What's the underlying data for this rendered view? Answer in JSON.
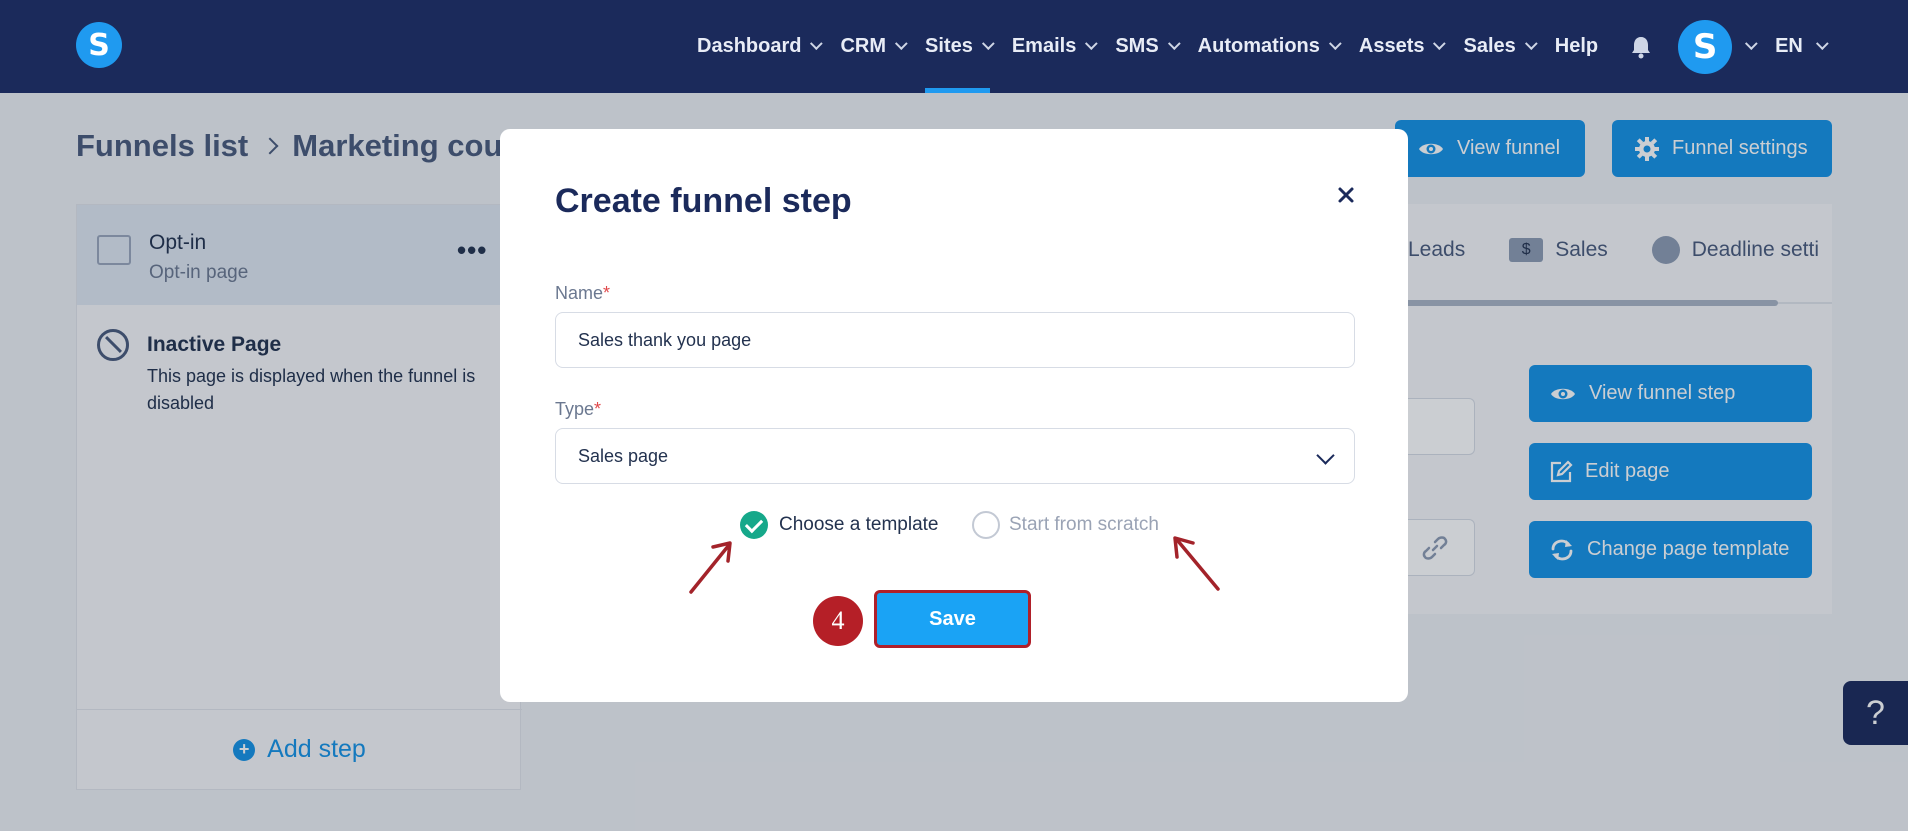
{
  "nav": {
    "logo_letter": "S",
    "items": [
      {
        "label": "Dashboard",
        "dropdown": true,
        "active": false
      },
      {
        "label": "CRM",
        "dropdown": true,
        "active": false
      },
      {
        "label": "Sites",
        "dropdown": true,
        "active": true
      },
      {
        "label": "Emails",
        "dropdown": true,
        "active": false
      },
      {
        "label": "SMS",
        "dropdown": true,
        "active": false
      },
      {
        "label": "Automations",
        "dropdown": true,
        "active": false
      },
      {
        "label": "Assets",
        "dropdown": true,
        "active": false
      },
      {
        "label": "Sales",
        "dropdown": true,
        "active": false
      },
      {
        "label": "Help",
        "dropdown": false,
        "active": false
      }
    ],
    "avatar_letter": "S",
    "language": "EN"
  },
  "breadcrumb": {
    "root": "Funnels list",
    "current": "Marketing cour"
  },
  "header_buttons": {
    "view_funnel": "View funnel",
    "funnel_settings": "Funnel settings"
  },
  "steps_panel": {
    "step": {
      "title": "Opt-in",
      "subtitle": "Opt-in page",
      "menu": "•••"
    },
    "inactive": {
      "title": "Inactive Page",
      "description": "This page is displayed when the funnel is disabled"
    },
    "add_step": "Add step",
    "add_step_icon": "+"
  },
  "detail_tabs": [
    {
      "label": "Leads",
      "icon": "none"
    },
    {
      "label": "Sales",
      "icon": "dollar",
      "icon_text": "$"
    },
    {
      "label": "Deadline setti",
      "icon": "clock"
    }
  ],
  "detail_buttons": {
    "view_step": "View funnel step",
    "edit_page": "Edit page",
    "change_template": "Change page template"
  },
  "help_button": "?",
  "modal": {
    "title": "Create funnel step",
    "name_label": "Name",
    "name_value": "Sales thank you page",
    "type_label": "Type",
    "type_value": "Sales page",
    "required_mark": "*",
    "option_template": "Choose a template",
    "option_scratch": "Start from scratch",
    "selected_option": "Choose a template",
    "save_label": "Save",
    "step_badge": "4"
  },
  "colors": {
    "nav_bg": "#1b2a5b",
    "accent": "#1592e6",
    "annotation": "#b51f27",
    "check": "#16a88a"
  }
}
